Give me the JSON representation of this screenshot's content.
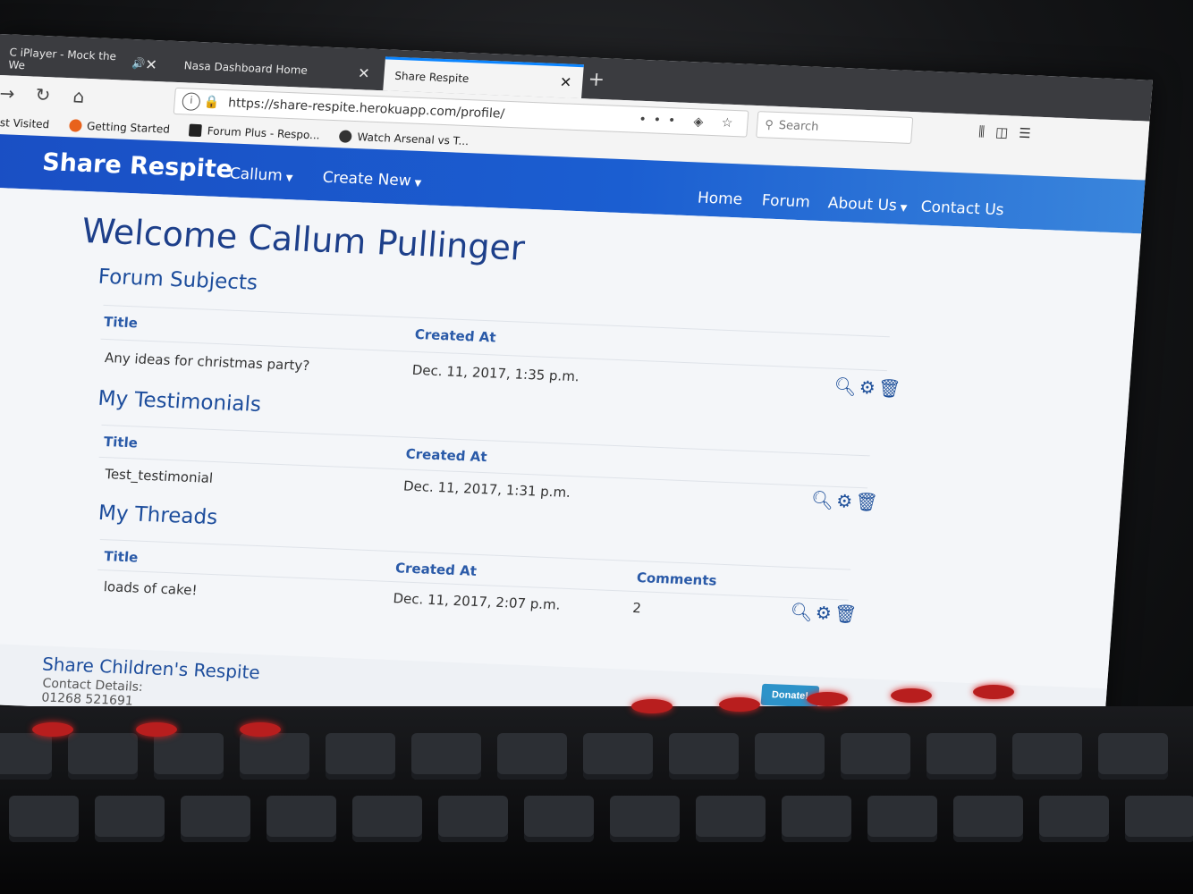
{
  "browser": {
    "tabs": [
      {
        "label": "C iPlayer - Mock the We"
      },
      {
        "label": "Nasa Dashboard Home"
      },
      {
        "label": "Share Respite"
      }
    ],
    "url": "https://share-respite.herokuapp.com/profile/",
    "search_placeholder": "Search",
    "bookmarks": [
      {
        "label": "ost Visited"
      },
      {
        "label": "Getting Started"
      },
      {
        "label": "Forum Plus - Respo..."
      },
      {
        "label": "Watch Arsenal vs T..."
      }
    ]
  },
  "site": {
    "brand": "Share Respite",
    "user_menu": "Callum",
    "create_menu": "Create New",
    "nav": {
      "home": "Home",
      "forum": "Forum",
      "about": "About Us",
      "contact": "Contact Us"
    }
  },
  "profile": {
    "welcome": "Welcome Callum Pullinger",
    "forum_subjects": {
      "heading": "Forum Subjects",
      "columns": {
        "title": "Title",
        "created": "Created At"
      },
      "rows": [
        {
          "title": "Any ideas for christmas party?",
          "created": "Dec. 11, 2017, 1:35 p.m."
        }
      ]
    },
    "testimonials": {
      "heading": "My Testimonials",
      "columns": {
        "title": "Title",
        "created": "Created At"
      },
      "rows": [
        {
          "title": "Test_testimonial",
          "created": "Dec. 11, 2017, 1:31 p.m."
        }
      ]
    },
    "threads": {
      "heading": "My Threads",
      "columns": {
        "title": "Title",
        "created": "Created At",
        "comments": "Comments"
      },
      "rows": [
        {
          "title": "loads of cake!",
          "created": "Dec. 11, 2017, 2:07 p.m.",
          "comments": "2"
        }
      ]
    }
  },
  "footer": {
    "title": "Share Children's Respite",
    "contact_label": "Contact Details:",
    "phone": "01268 521691",
    "donate": "Donate!"
  },
  "icons": {
    "view": "search-icon",
    "edit": "gear-icon",
    "delete": "trash-icon"
  },
  "colors": {
    "nav": "#1b5ed1",
    "heading": "#1d4d9c",
    "donate": "#2d93c9"
  }
}
